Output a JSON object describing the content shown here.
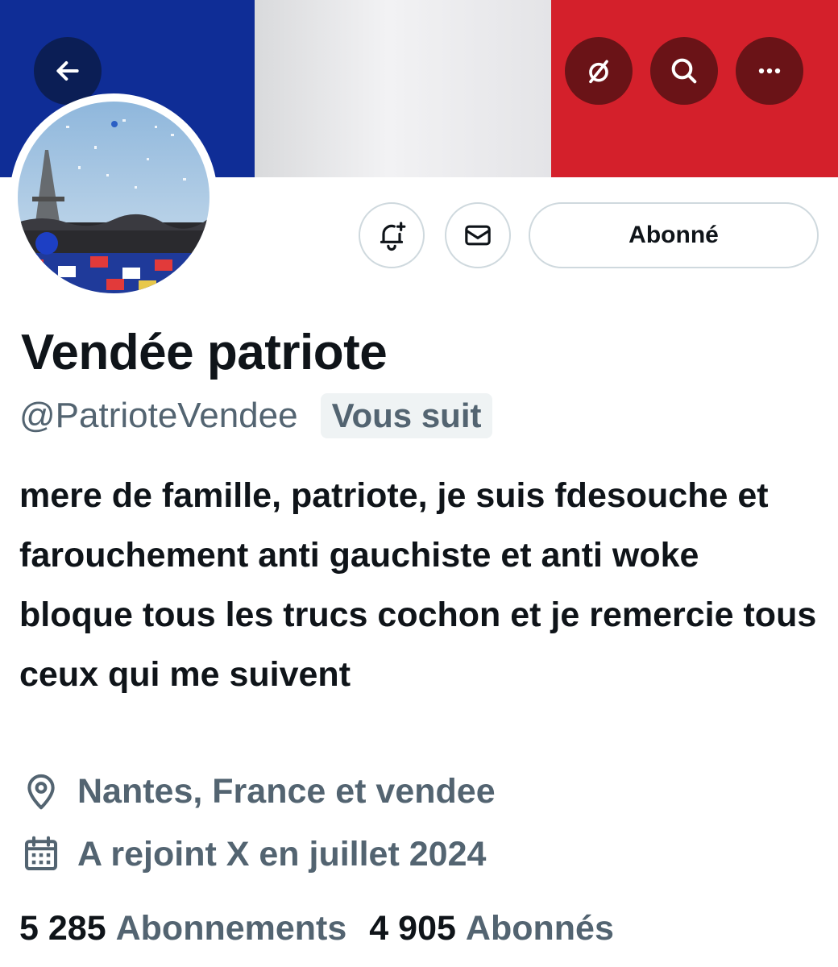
{
  "banner": {
    "colors": {
      "blue": "#0f2d96",
      "white": "#e8e8ea",
      "red": "#d4202b"
    },
    "back_icon": "arrow-left-icon",
    "mute_icon": "mute-circle-icon",
    "search_icon": "search-icon",
    "more_icon": "more-horizontal-icon"
  },
  "actions": {
    "notify_icon": "bell-plus-icon",
    "message_icon": "envelope-icon",
    "follow_label": "Abonné"
  },
  "profile": {
    "display_name": "Vendée patriote",
    "handle": "@PatrioteVendee",
    "follows_you": "Vous suit",
    "bio": "mere de famille, patriote, je suis fdesouche et farouchement anti gauchiste et anti woke bloque tous les trucs cochon et je remercie tous ceux qui me suivent",
    "location": "Nantes, France et vendee",
    "joined": "A rejoint X en juillet 2024"
  },
  "stats": {
    "following_count": "5 285",
    "following_label": "Abonnements",
    "followers_count": "4 905",
    "followers_label": "Abonnés"
  },
  "colors": {
    "secondary_text": "#536471",
    "primary_text": "#0f1419",
    "border": "#cfd9de"
  }
}
